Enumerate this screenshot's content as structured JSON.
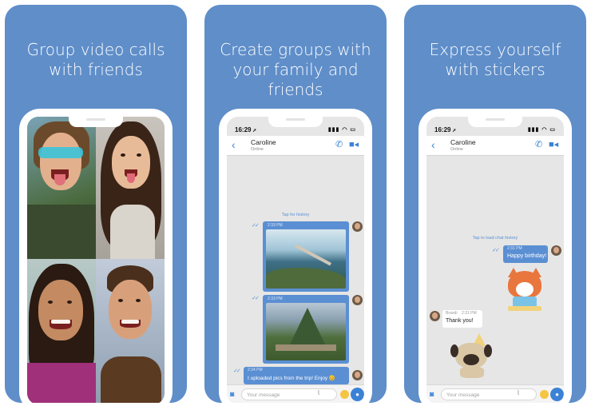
{
  "panels": [
    {
      "headline_line1": "Group video calls",
      "headline_line2": "with friends"
    },
    {
      "headline_line1": "Create groups with",
      "headline_line2": "your family and friends"
    },
    {
      "headline_line1": "Express yourself",
      "headline_line2": "with stickers"
    }
  ],
  "status": {
    "time": "16:29",
    "indicators": "▮▮▮ ◠ ▭"
  },
  "chat": {
    "contact_name": "Caroline",
    "contact_status": "Online",
    "back_icon": "chevron-left-icon",
    "call_icon": "phone-icon",
    "video_icon": "video-camera-icon",
    "input_placeholder": "Your message"
  },
  "group_chat": {
    "tap_history": "Tap for history",
    "messages": [
      {
        "time": "2:33 PM",
        "type": "photo",
        "scene": "pier-at-sea"
      },
      {
        "time": "2:33 PM",
        "type": "photo",
        "scene": "mountain-ruins"
      },
      {
        "time": "2:34 PM",
        "type": "text",
        "text": "I uploaded pics from the trip! Enjoy 😊"
      }
    ]
  },
  "sticker_chat": {
    "tap_history": "Tap to load chat history",
    "messages": [
      {
        "time": "2:31 PM",
        "type": "text",
        "text": "Happy birthday!",
        "direction": "out"
      },
      {
        "type": "sticker",
        "sticker": "fox-with-cake",
        "direction": "out"
      },
      {
        "sender": "Brandi",
        "time": "2:31 PM",
        "type": "text",
        "text": "Thank you!",
        "direction": "in"
      },
      {
        "type": "sticker",
        "sticker": "pug-party-hat",
        "direction": "in"
      }
    ]
  },
  "colors": {
    "panel": "#5f8ec9",
    "accent": "#3b82d6",
    "bubble": "#5b8fd3"
  }
}
